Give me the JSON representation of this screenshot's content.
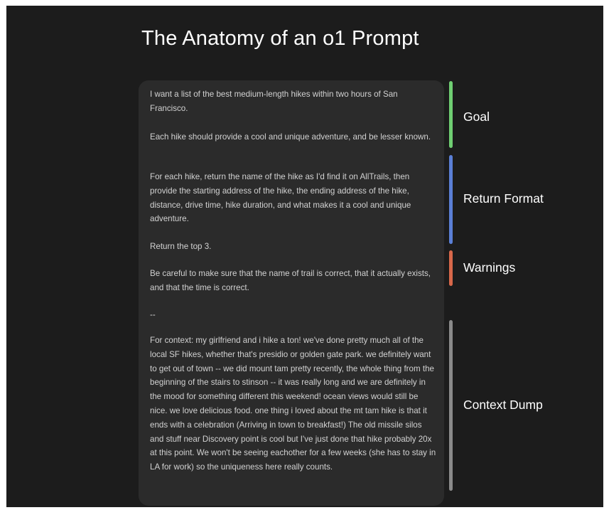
{
  "title": "The Anatomy of an o1 Prompt",
  "prompt": {
    "paragraphs": [
      "I want a list of the best medium-length hikes within two hours of San Francisco.",
      "Each hike should provide a cool and unique adventure, and be lesser known.",
      "For each hike, return the name of the hike as I'd find it on AllTrails, then provide the starting address of the hike, the ending address of the hike, distance, drive time, hike duration, and what makes it a cool and unique adventure.",
      "Return the top 3.",
      "Be careful to make sure that the name of trail is correct, that it actually exists, and that the time is correct.",
      "--",
      "For context: my girlfriend and i hike a ton! we've done pretty much all of the local SF hikes, whether that's presidio or golden gate park. we definitely want to get out of town -- we did mount tam pretty recently, the whole thing from the beginning of the stairs to stinson -- it was really long and we are definitely in the mood for something different this weekend! ocean views would still be nice. we love delicious food. one thing i loved about the mt tam hike is that it ends with a celebration (Arriving in town to breakfast!) The old missile silos and stuff near Discovery point is cool but I've just done that hike probably 20x at this point. We won't be seeing eachother for a few weeks (she has to stay in LA for work) so the uniqueness here really counts."
    ]
  },
  "sections": [
    {
      "label": "Goal",
      "color": "#6fce72"
    },
    {
      "label": "Return Format",
      "color": "#5a7fd6"
    },
    {
      "label": "Warnings",
      "color": "#d8684a"
    },
    {
      "label": "Context Dump",
      "color": "#8a8a8a"
    }
  ]
}
